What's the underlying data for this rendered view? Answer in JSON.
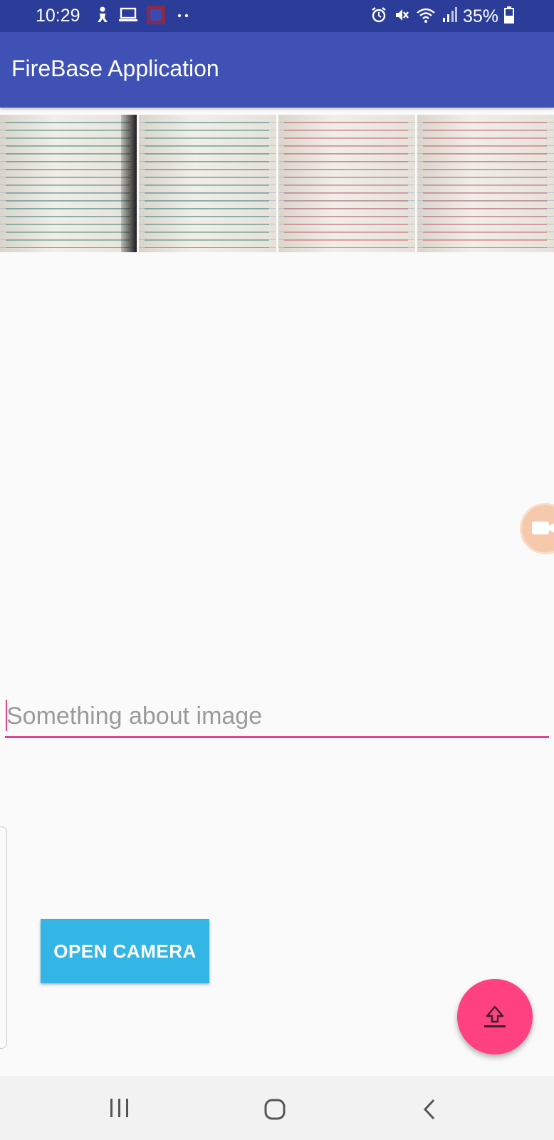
{
  "status_bar": {
    "time": "10:29",
    "battery": "35%",
    "left_icons": [
      "figure-icon",
      "laptop-icon",
      "app-thumbnail-icon",
      "more-dots-icon"
    ],
    "right_icons": [
      "alarm-icon",
      "mute-icon",
      "wifi-icon",
      "signal-icon",
      "battery-icon"
    ]
  },
  "app_bar": {
    "title": "FireBase Application"
  },
  "gallery": {
    "images": [
      "notebook-page-photo",
      "notebook-page-photo",
      "notebook-page-photo",
      "notebook-page-photo"
    ]
  },
  "caption": {
    "placeholder": "Something about image",
    "value": ""
  },
  "actions": {
    "open_camera_label": "OPEN CAMERA",
    "upload_icon": "upload-icon"
  },
  "nav_bar": {
    "buttons": [
      "recent-apps-icon",
      "home-icon",
      "back-icon"
    ]
  },
  "colors": {
    "status_bar": "#2c3d99",
    "app_bar": "#3f51b5",
    "accent": "#e0458a",
    "open_camera": "#33b5e5",
    "fab": "#ff4081"
  }
}
